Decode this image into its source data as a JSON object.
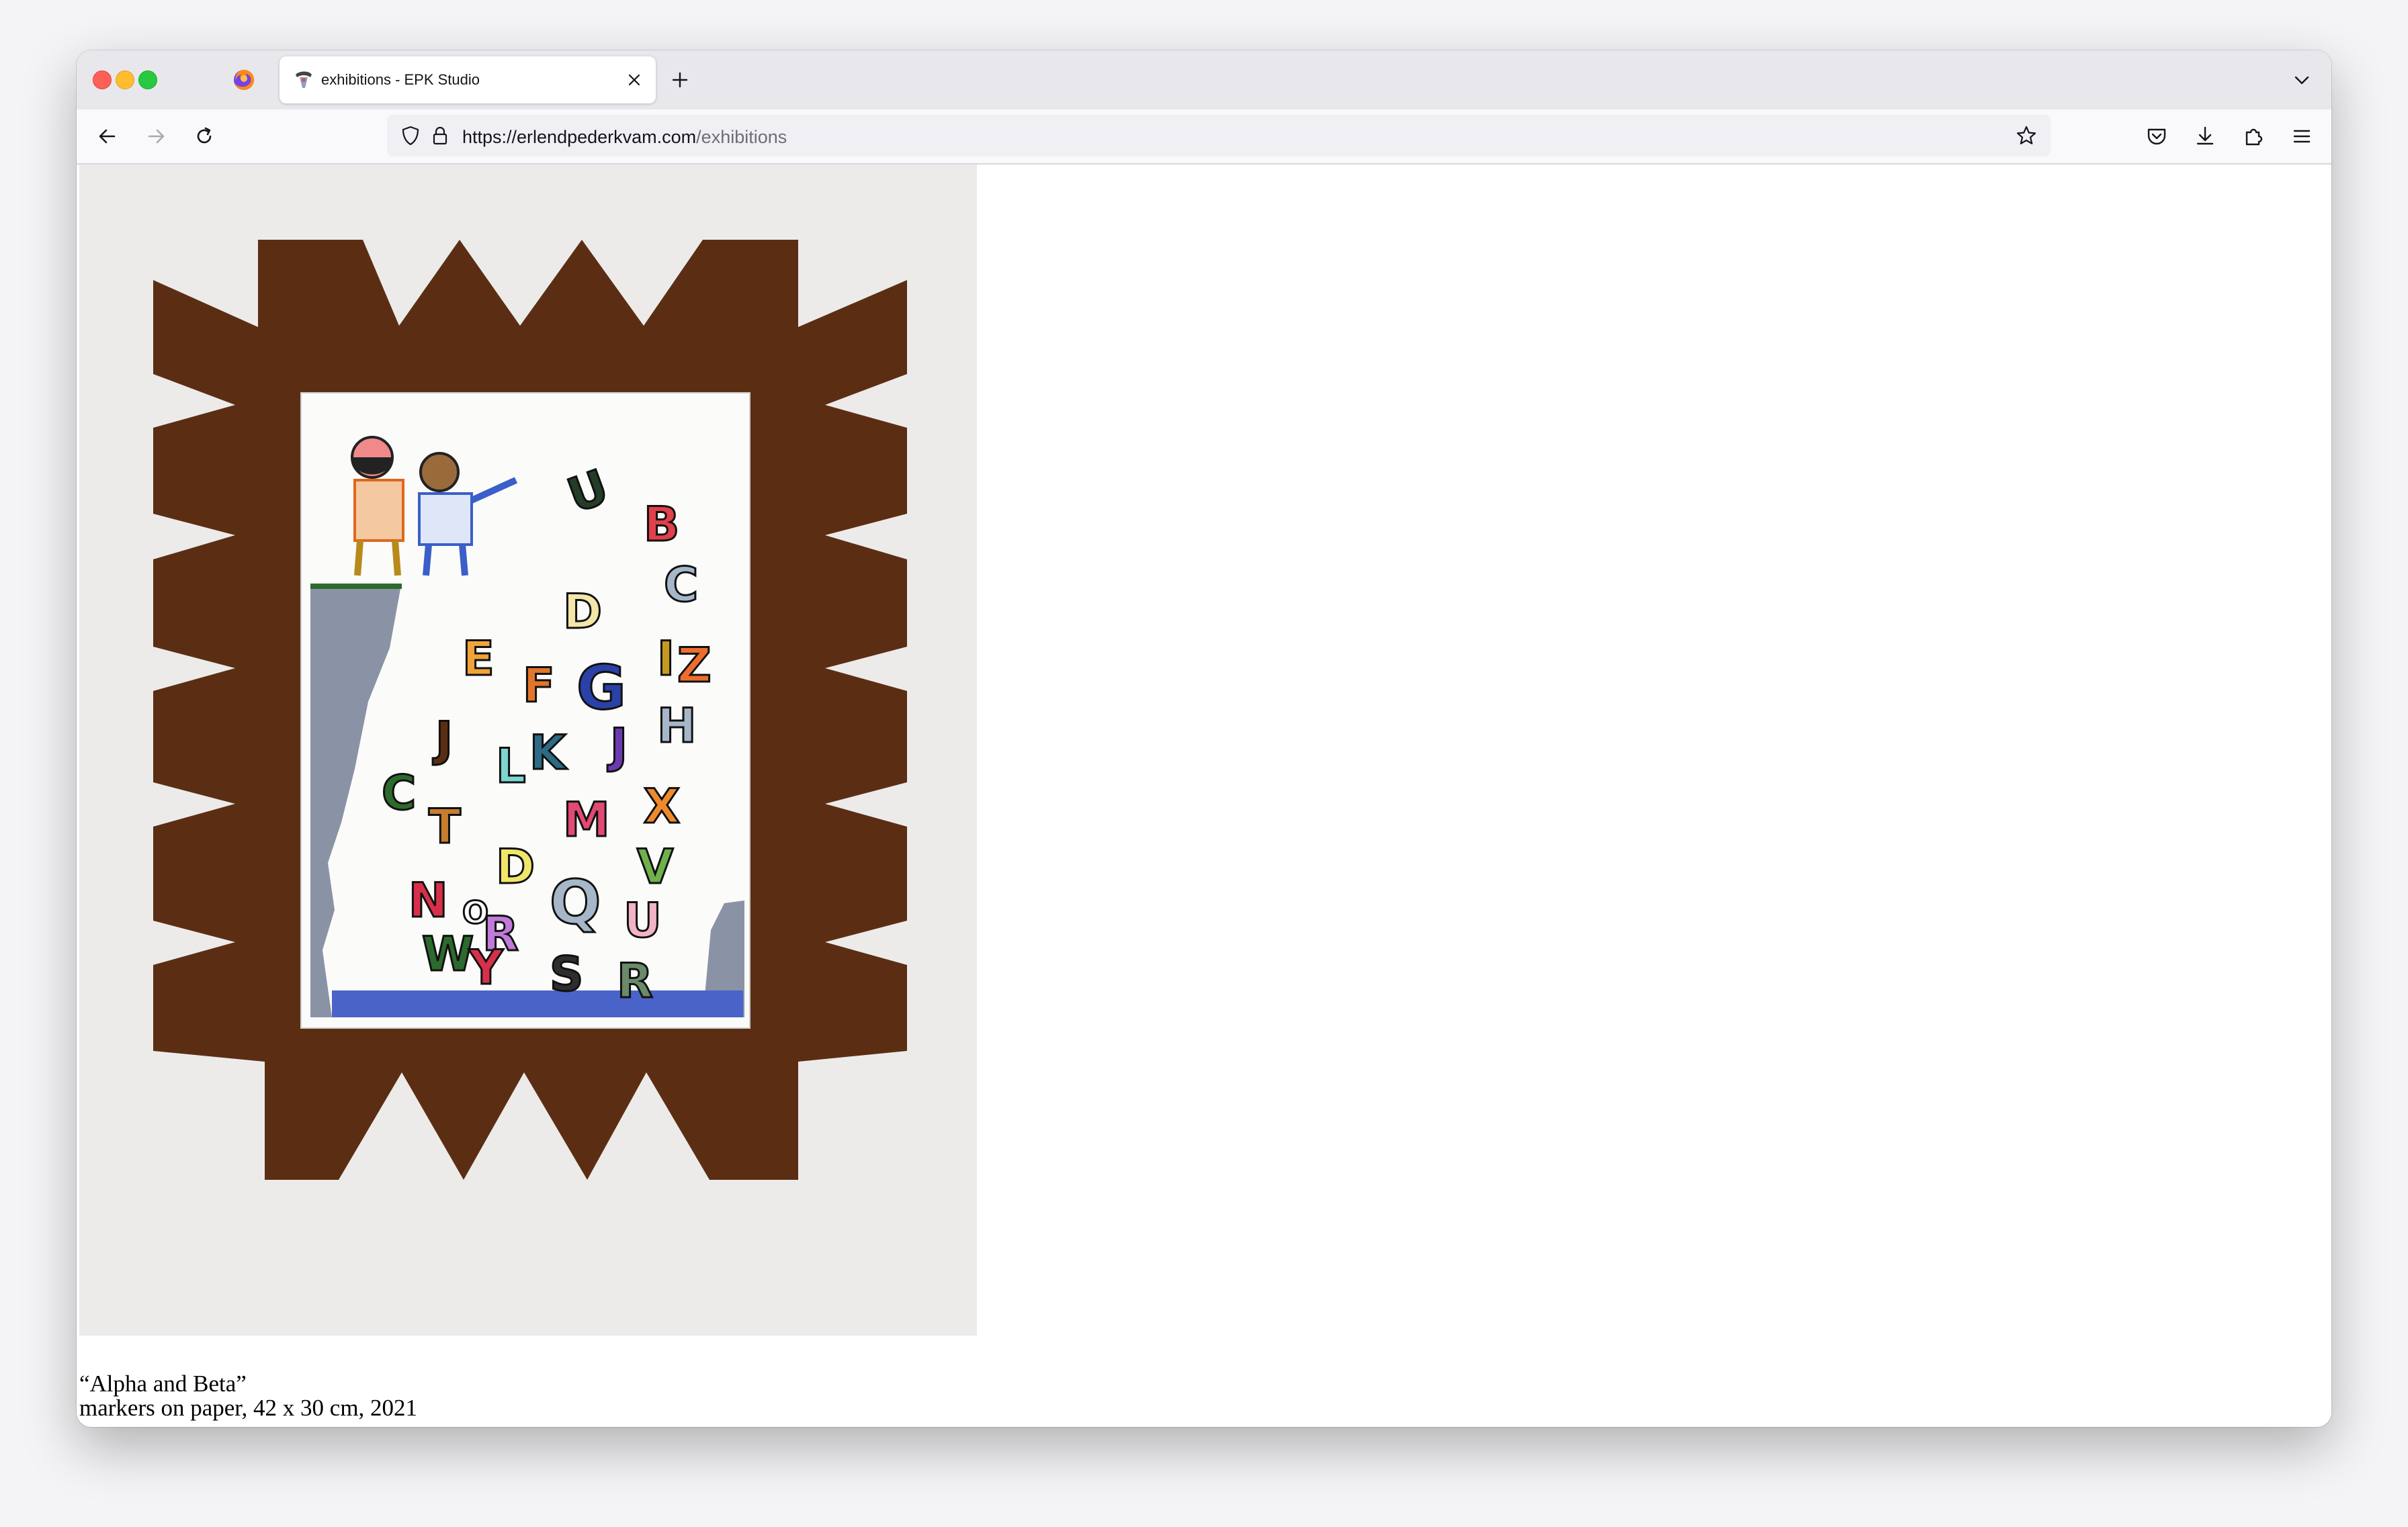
{
  "browser": {
    "tab": {
      "title": "exhibitions - EPK Studio"
    },
    "url": {
      "full": "https://erlendpederkvam.com/exhibitions",
      "scheme": "https://",
      "host": "erlendpederkvam.com",
      "path": "/exhibitions"
    },
    "icons": {
      "back": "arrow-left-icon",
      "forward": "arrow-right-icon",
      "reload": "reload-icon",
      "shield": "tracking-protection-icon",
      "lock": "lock-icon",
      "bookmark": "star-icon",
      "pocket": "pocket-icon",
      "downloads": "download-icon",
      "extensions": "extensions-icon",
      "menu": "hamburger-menu-icon",
      "new_tab": "plus-icon",
      "tab_list": "chevron-down-icon",
      "close_tab": "close-icon"
    }
  },
  "page": {
    "artwork": {
      "title": "“Alpha and Beta”",
      "details": "markers on paper, 42 x 30 cm, 2021"
    }
  },
  "colors": {
    "frame_brown": "#5b2e14",
    "cliff_gray": "#8a93a6",
    "water_blue": "#4a63c8",
    "wall": "#ecebea"
  }
}
